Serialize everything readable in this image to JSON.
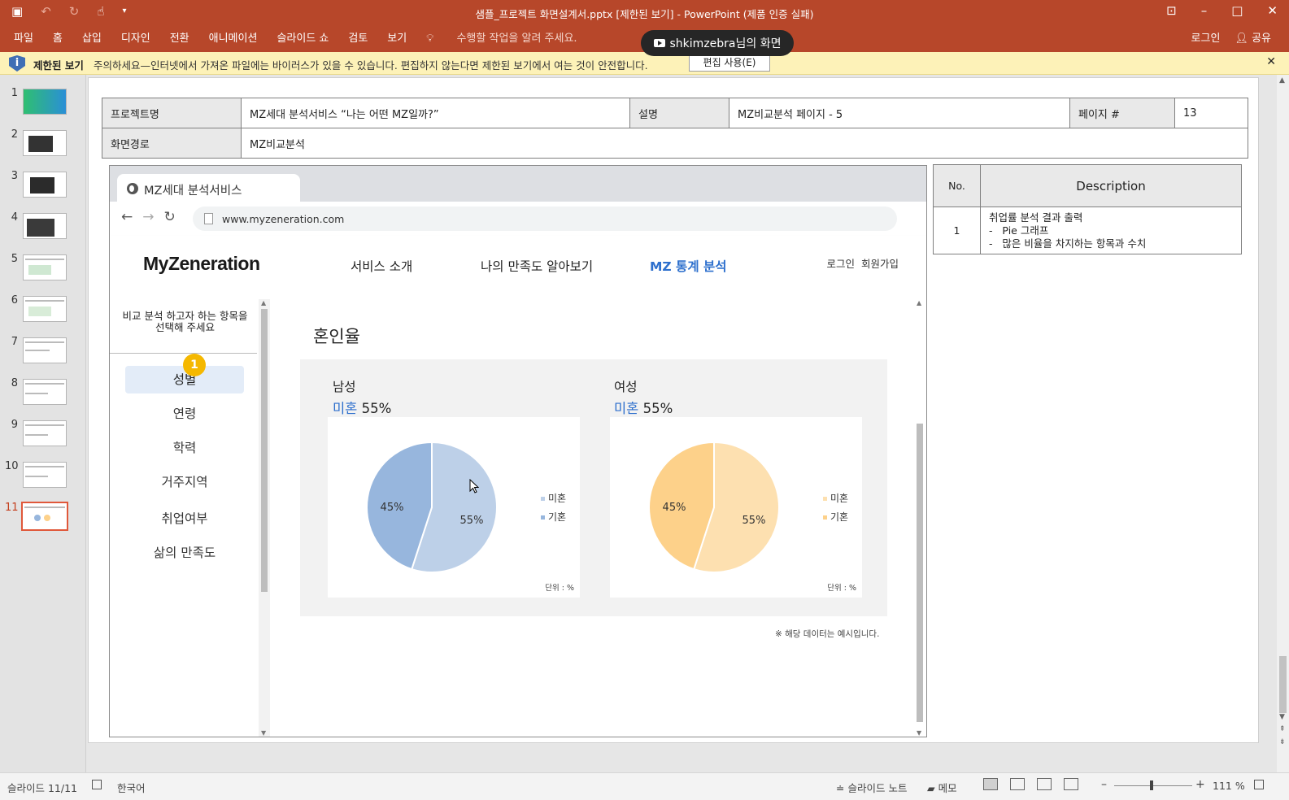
{
  "window": {
    "title": "샘플_프로젝트 화면설계서.pptx [제한된 보기] - PowerPoint (제품 인증 실패)",
    "qat_icons": [
      "save-icon",
      "undo-icon",
      "redo-icon",
      "touch-mode-icon",
      "customize-icon"
    ]
  },
  "ribbon": {
    "tabs": [
      "파일",
      "홈",
      "삽입",
      "디자인",
      "전환",
      "애니메이션",
      "슬라이드 쇼",
      "검토",
      "보기"
    ],
    "tell_me": "수행할 작업을 알려 주세요.",
    "login": "로그인",
    "share": "공유"
  },
  "screen_share": {
    "label": "shkimzebra님의 화면"
  },
  "message_bar": {
    "label": "제한된 보기",
    "text": "주의하세요—인터넷에서 가져온 파일에는 바이러스가 있을 수 있습니다. 편집하지 않는다면 제한된 보기에서 여는 것이 안전합니다.",
    "button": "편집 사용(E)"
  },
  "thumbnails": [
    {
      "num": "1"
    },
    {
      "num": "2"
    },
    {
      "num": "3"
    },
    {
      "num": "4"
    },
    {
      "num": "5"
    },
    {
      "num": "6"
    },
    {
      "num": "7"
    },
    {
      "num": "8"
    },
    {
      "num": "9"
    },
    {
      "num": "10"
    },
    {
      "num": "11",
      "active": true
    }
  ],
  "header_table": {
    "project_label": "프로젝트명",
    "project_value": "MZ세대 분석서비스 “나는 어떤 MZ일까?”",
    "desc_label": "설명",
    "desc_value": "MZ비교분석 페이지 - 5",
    "page_label": "페이지 #",
    "page_value": "13",
    "path_label": "화면경로",
    "path_value": "MZ비교분석"
  },
  "browser": {
    "tab_title": "MZ세대 분석서비스",
    "url": "www.myzeneration.com"
  },
  "site": {
    "logo": "MyZeneration",
    "nav": [
      "서비스 소개",
      "나의 만족도 알아보기",
      "MZ 통계 분석"
    ],
    "auth_login": "로그인",
    "auth_signup": "회원가입"
  },
  "sidebar": {
    "prompt_line1": "비교 분석 하고자 하는 항목을",
    "prompt_line2": "선택해 주세요",
    "items": [
      "성별",
      "연령",
      "학력",
      "거주지역",
      "취업여부",
      "삶의 만족도"
    ]
  },
  "content": {
    "section_title": "혼인율",
    "badge": "1",
    "male_label": "남성",
    "female_label": "여성",
    "rate_key": "미혼",
    "male_rate": "55%",
    "female_rate": "55%",
    "unit": "단위 : %",
    "note": "※ 해당 데이터는 예시입니다."
  },
  "chart_data": [
    {
      "type": "pie",
      "title": "남성",
      "categories": [
        "미혼",
        "기혼"
      ],
      "values": [
        55,
        45
      ],
      "labels": [
        "55%",
        "45%"
      ],
      "colors": [
        "#bdd0e8",
        "#97b6dd"
      ],
      "legend": "right",
      "unit": "단위 : %"
    },
    {
      "type": "pie",
      "title": "여성",
      "categories": [
        "미혼",
        "기혼"
      ],
      "values": [
        55,
        45
      ],
      "labels": [
        "55%",
        "45%"
      ],
      "colors": [
        "#fde0b0",
        "#fdd18a"
      ],
      "legend": "right",
      "unit": "단위 : %"
    }
  ],
  "desc_table": {
    "col_no": "No.",
    "col_desc": "Description",
    "row_no": "1",
    "line1": "취업률 분석 결과 출력",
    "line2": "-   Pie 그래프",
    "line3": "-   많은 비율을 차지하는 항목과 수치"
  },
  "statusbar": {
    "slide_info": "슬라이드 11/11",
    "language": "한국어",
    "notes": "슬라이드 노트",
    "comments": "메모",
    "zoom": "111 %"
  }
}
